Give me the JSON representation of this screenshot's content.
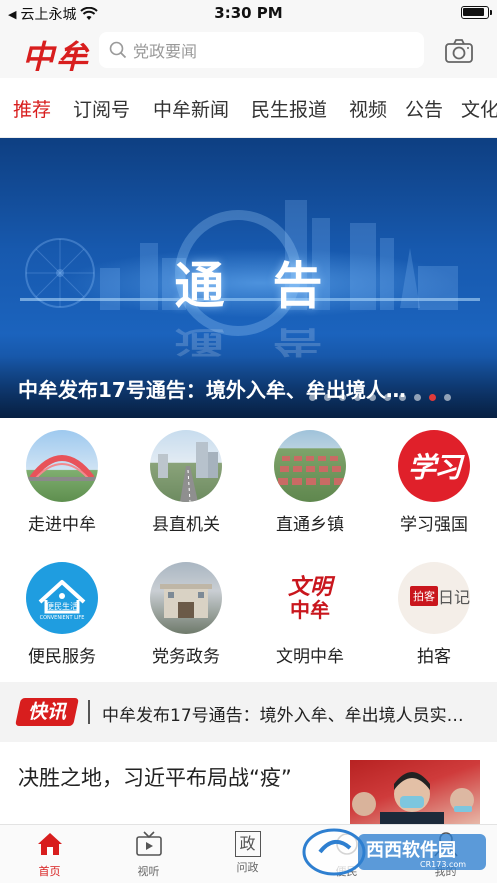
{
  "status_bar": {
    "carrier": "云上永城",
    "time": "3:30 PM"
  },
  "header": {
    "logo": "中牟",
    "search_placeholder": "党政要闻"
  },
  "tabs": [
    "推荐",
    "订阅号",
    "中牟新闻",
    "民生报道",
    "视频",
    "公告",
    "文化"
  ],
  "banner": {
    "image_title": "通告",
    "caption": "中牟发布17号通告：境外入牟、牟出境人…",
    "dot_count": 10,
    "active_dot": 8
  },
  "grid": [
    {
      "label": "走进中牟",
      "icon": "bridge-photo-icon"
    },
    {
      "label": "县直机关",
      "icon": "city-street-photo-icon"
    },
    {
      "label": "直通乡镇",
      "icon": "village-aerial-photo-icon"
    },
    {
      "label": "学习强国",
      "icon": "xuexi-logo-icon"
    },
    {
      "label": "便民服务",
      "icon": "convenient-life-icon"
    },
    {
      "label": "党务政务",
      "icon": "government-building-photo-icon"
    },
    {
      "label": "文明中牟",
      "icon": "wenming-zhongmu-icon"
    },
    {
      "label": "拍客",
      "icon": "paike-diary-icon"
    }
  ],
  "convenient_life": {
    "cn": "便民生活",
    "en": "CONVENIENT LIFE"
  },
  "wenming": {
    "line1": "文明",
    "line2": "中牟"
  },
  "xuexi": "学习",
  "paike": {
    "tag": "拍客",
    "text": "日记"
  },
  "flash": {
    "badge": "快讯",
    "text": "中牟发布17号通告：境外入牟、牟出境人员实…"
  },
  "article": {
    "headline": "决胜之地，习近平布局战“疫”"
  },
  "bottom_nav": [
    {
      "label": "首页",
      "icon": "home-icon",
      "active": true
    },
    {
      "label": "视听",
      "icon": "tv-icon",
      "active": false
    },
    {
      "label": "问政",
      "icon": "zheng-icon",
      "glyph": "政",
      "active": false
    },
    {
      "label": "便民",
      "icon": "service-icon",
      "active": false
    },
    {
      "label": "我的",
      "icon": "profile-icon",
      "active": false
    }
  ],
  "watermark": {
    "brand": "西西软件园",
    "url": "CR173.com"
  },
  "colors": {
    "accent": "#d81e1e",
    "banner_blue": "#1759ae"
  }
}
